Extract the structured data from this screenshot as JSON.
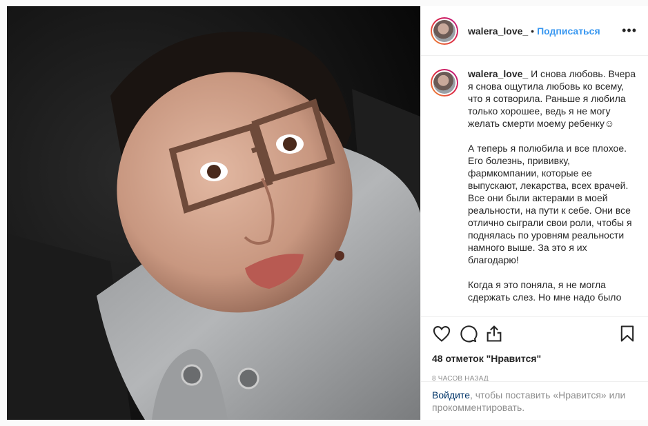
{
  "post": {
    "username": "walera_love_",
    "follow_label": "Подписаться",
    "dot": "•",
    "more_label": "•••",
    "caption": "И снова любовь. Вчера я снова ощутила любовь ко всему, что я сотворила. Раньше я любила только хорошее, ведь я не могу желать смерти моему ребенку☺\n\nА теперь я полюбила и все плохое. Его болезнь, прививку, фармкомпании, которые ее выпускают, лекарства, всех врачей. Все они были актерами в моей реальности, на пути к себе. Они все отлично сыграли свои роли, чтобы я поднялась по уровням реальности намного выше. За это я их благодарю!\n\nКогда я это поняла, я не могла сдержать слез. Но мне надо было",
    "likes": "48 отметок \"Нравится\"",
    "time": "8 часов назад",
    "login_link": "Войдите",
    "login_text": ", чтобы поставить «Нравится» или прокомментировать."
  },
  "icons": {
    "like": "heart-icon",
    "comment": "comment-icon",
    "share": "share-icon",
    "save": "bookmark-icon",
    "more": "more-icon"
  },
  "colors": {
    "accent": "#3897f0",
    "link": "#003569",
    "muted": "#8e8e8e",
    "text": "#262626"
  }
}
